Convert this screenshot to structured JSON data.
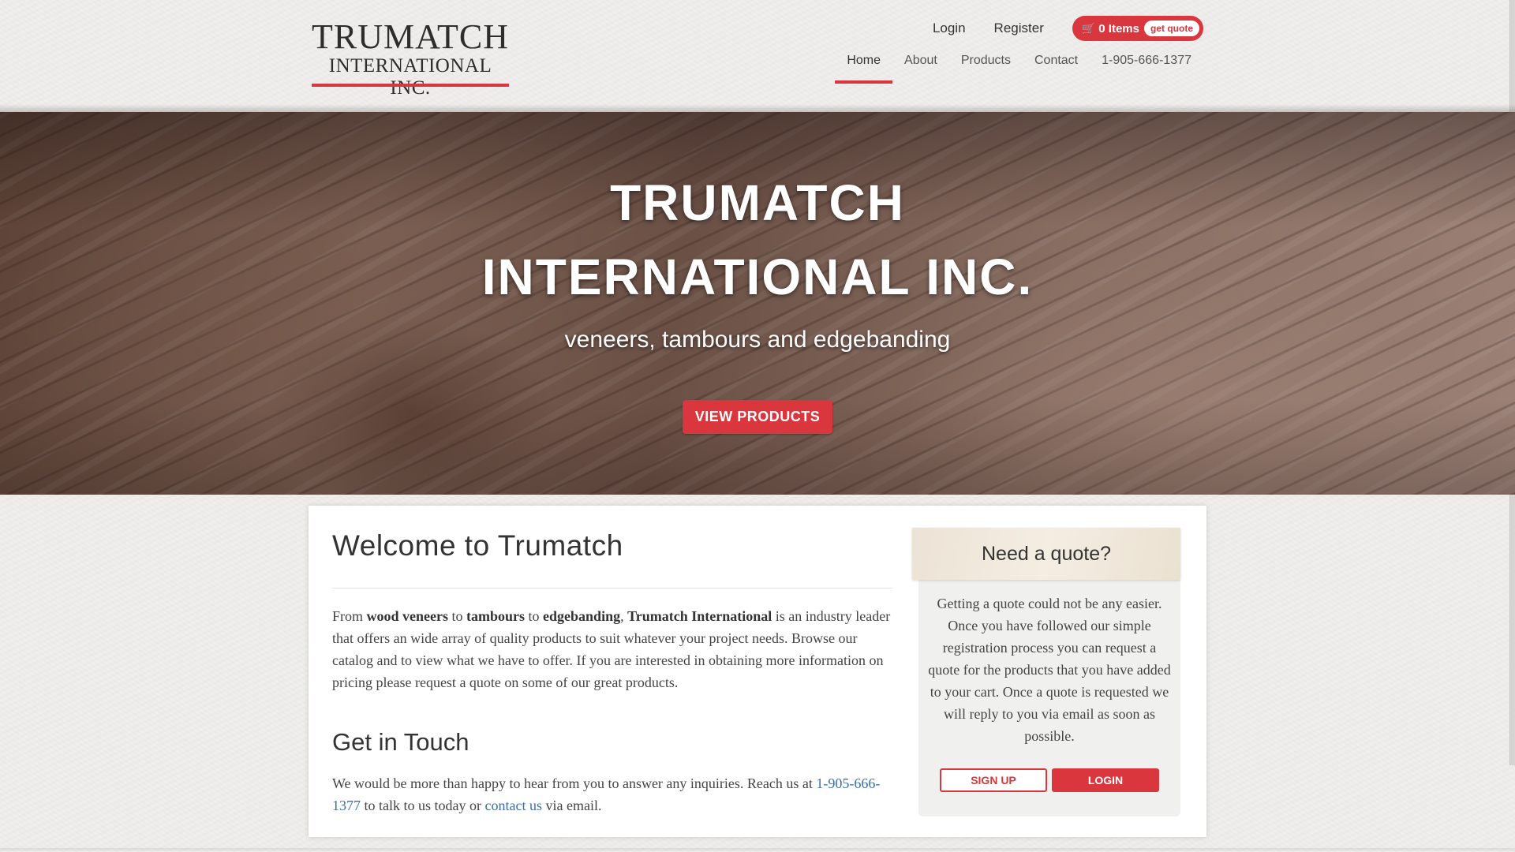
{
  "brand": {
    "logo_line1": "TRUMATCH",
    "logo_line2": "INTERNATIONAL INC.",
    "accent_color": "#d9363e"
  },
  "top_links": {
    "login": "Login",
    "register": "Register",
    "cart_icon": "cart-icon",
    "cart_count": "0 Items",
    "cart_quote": "get quote"
  },
  "nav": {
    "items": [
      "Home",
      "About",
      "Products",
      "Contact",
      "1-905-666-1377"
    ],
    "active": "Home"
  },
  "hero": {
    "title_line1": "TRUMATCH",
    "title_line2": "INTERNATIONAL INC.",
    "subtitle": "veneers, tambours and edgebanding",
    "button": "VIEW PRODUCTS"
  },
  "welcome": {
    "title": "Welcome to Trumatch",
    "p_from": "From ",
    "p_b1": "wood veneers",
    "p_to1": " to ",
    "p_b2": "tambours",
    "p_to2": " to ",
    "p_b3": "edgebanding",
    "p_comma": ", ",
    "p_b4": "Trumatch International",
    "p_rest": " is an industry leader that offers an wide array of quality products to suit whatever your project needs. Browse our catalog and to view what we have to offer. If you are interested in obtaining more information on pricing please request a quote on some of our great products."
  },
  "touch": {
    "title": "Get in Touch",
    "text_before": "We would be more than happy to hear from you to answer any inquiries. Reach us at ",
    "phone": "1-905-666-1377",
    "text_middle": " to talk to us today or ",
    "contact_link": "contact us",
    "text_after": " via email."
  },
  "quote": {
    "title": "Need a quote?",
    "text": "Getting a quote could not be any easier. Once you have followed our simple registration process you can request a quote for the products that you have added to your cart. Once a quote is requested we will reply to you via email as soon as possible.",
    "signup": "SIGN UP",
    "login": "LOGIN"
  }
}
